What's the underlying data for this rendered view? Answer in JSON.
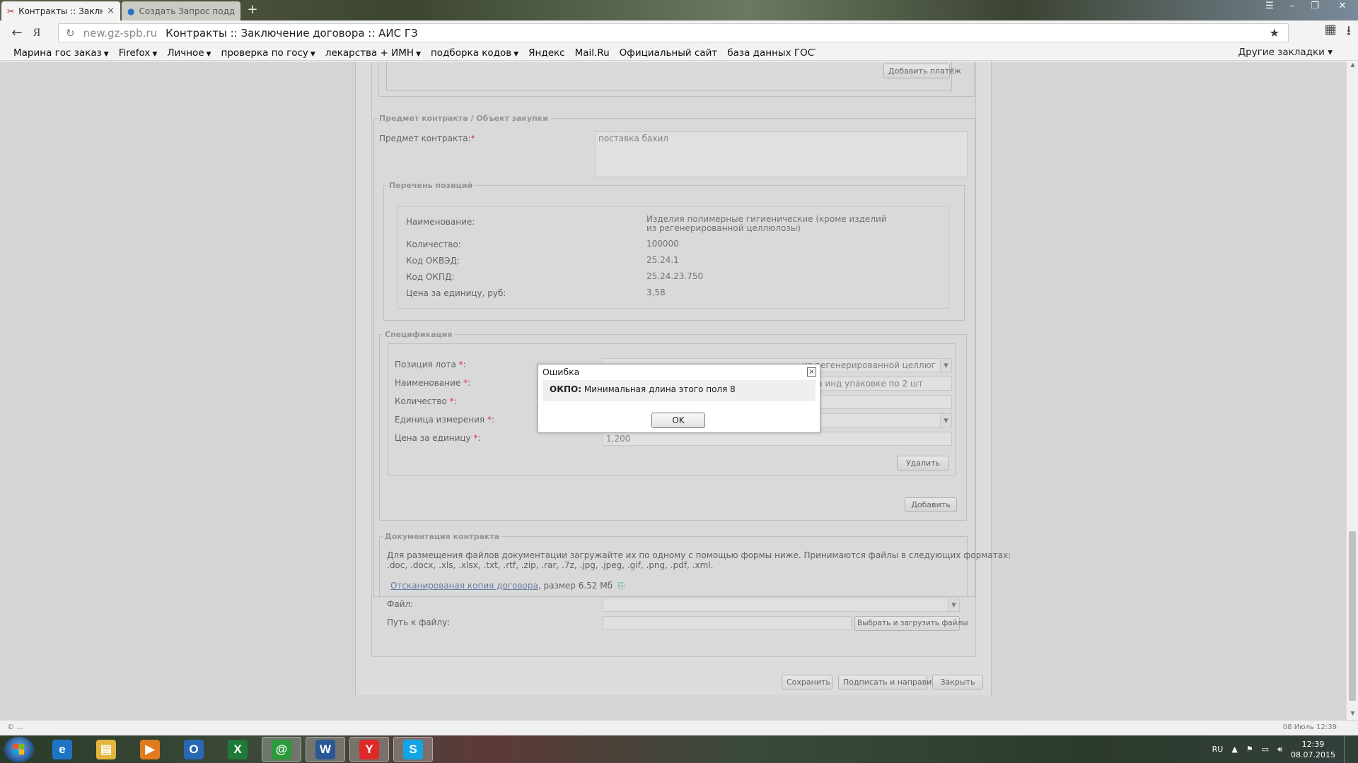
{
  "browser": {
    "tabs": [
      {
        "label": "Контракты :: Заключе",
        "active": true,
        "close": "×"
      },
      {
        "label": "Создать Запрос подд",
        "active": false
      }
    ],
    "new_tab": "+",
    "address": {
      "host": "new.gz-spb.ru",
      "title": "Контракты :: Заключение договора :: АИС ГЗ"
    },
    "bookmarks": [
      {
        "label": "Марина гос заказ",
        "arrow": "▼"
      },
      {
        "label": "Firefox",
        "arrow": "▼"
      },
      {
        "label": "Личное",
        "arrow": "▼"
      },
      {
        "label": "проверка по госу",
        "arrow": "▼"
      },
      {
        "label": "лекарства + ИМН",
        "arrow": "▼"
      },
      {
        "label": "подборка кодов",
        "arrow": "▼"
      },
      {
        "label": "Яндекс"
      },
      {
        "label": "Mail.Ru"
      },
      {
        "label": "Официальный сайт"
      },
      {
        "label": "база данных ГОСТ Т"
      }
    ],
    "other_bookmarks": "Другие закладки ▾"
  },
  "page": {
    "payments": {
      "add_payment_button": "Добавить платёж"
    },
    "subject_section": {
      "legend": "Предмет контракта / Объект закупки",
      "subject_label": "Предмет контракта:",
      "req": "*",
      "subject_value": "поставка бахил"
    },
    "positions": {
      "legend": "Перечень позиций",
      "rows": [
        {
          "label": "Наименование:",
          "value": "Изделия полимерные гигиенические (кроме изделий из регенерированной целлюлозы)"
        },
        {
          "label": "Количество:",
          "value": "100000"
        },
        {
          "label": "Код ОКВЭД:",
          "value": "25.24.1"
        },
        {
          "label": "Код ОКПД:",
          "value": "25.24.23.750"
        },
        {
          "label": "Цена за единицу, руб:",
          "value": "3,58"
        }
      ]
    },
    "specification": {
      "legend": "Спецификация",
      "req": "*",
      "fields": [
        {
          "label": "Позиция лота",
          "value": "из регенерированной целлюг"
        },
        {
          "label": "Наименование",
          "value": "е в инд упаковке по 2 шт"
        },
        {
          "label": "Количество",
          "value": ""
        },
        {
          "label": "Единица измерения",
          "value": ""
        },
        {
          "label": "Цена за единицу",
          "value": "1,200"
        }
      ],
      "delete_button": "Удалить",
      "add_button": "Добавить"
    },
    "documentation": {
      "legend": "Документация контракта",
      "info_line1": "Для размещения файлов документации загружайте их по одному с помощью формы ниже. Принимаются файлы в следующих форматах:",
      "info_line2": ".doc, .docx, .xls, .xlsx, .txt, .rtf, .zip, .rar, .7z, .jpg, .jpeg, .gif, .png, .pdf, .xml.",
      "file_link": "Отсканированая копия договора",
      "file_size": ", размер 6.52 Мб",
      "file_label": "Файл:",
      "path_label": "Путь к файлу:",
      "upload_button": "Выбрать и загрузить файлы"
    },
    "footer_buttons": {
      "save": "Сохранить",
      "sign_send": "Подписать и направить",
      "close": "Закрыть"
    }
  },
  "dialog": {
    "title": "Ошибка",
    "close": "×",
    "field": "ОКПО:",
    "message": "Минимальная длина этого поля 8",
    "ok_button": "OK"
  },
  "statusbar": {
    "left": "© ...",
    "right": "08 Июль 12:39"
  },
  "taskbar": {
    "apps": [
      {
        "name": "internet-explorer",
        "glyph": "e",
        "color": "#1d74c7"
      },
      {
        "name": "explorer",
        "glyph": "▤",
        "color": "#e3b53d"
      },
      {
        "name": "media-player",
        "glyph": "▶",
        "color": "#e07a1f"
      },
      {
        "name": "outlook",
        "glyph": "O",
        "color": "#2869b5"
      },
      {
        "name": "excel",
        "glyph": "X",
        "color": "#1f7a3a"
      },
      {
        "name": "mail-agent",
        "glyph": "@",
        "color": "#2a9a3a"
      },
      {
        "name": "word",
        "glyph": "W",
        "color": "#2b5797"
      },
      {
        "name": "yandex-browser",
        "glyph": "Y",
        "color": "#e02a2a"
      },
      {
        "name": "skype",
        "glyph": "S",
        "color": "#12a5e6"
      }
    ],
    "lang": "RU",
    "time": "12:39",
    "date": "08.07.2015"
  }
}
